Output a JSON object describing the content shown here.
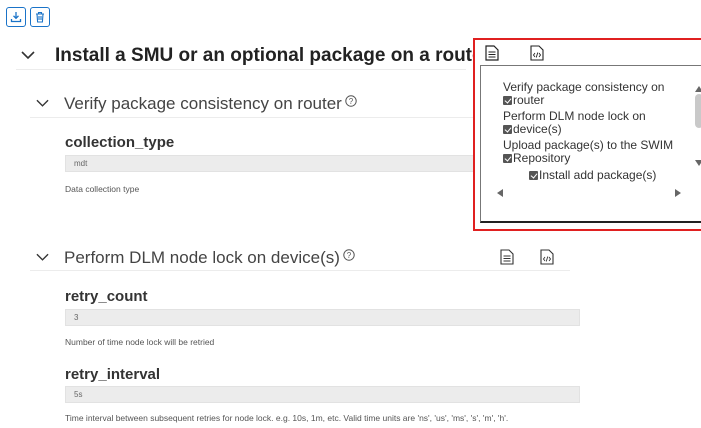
{
  "toolbar": {
    "download_icon": "download-icon",
    "delete_icon": "trash-icon"
  },
  "sections": {
    "main": {
      "title": "Install a SMU or an optional package on a router"
    },
    "verify": {
      "title": "Verify package consistency on router"
    },
    "dlm": {
      "title": "Perform DLM node lock on device(s)"
    }
  },
  "fields": {
    "collection_type": {
      "label": "collection_type",
      "value": "mdt",
      "description": "Data collection type"
    },
    "retry_count": {
      "label": "retry_count",
      "value": "3",
      "description": "Number of time node lock will be retried"
    },
    "retry_interval": {
      "label": "retry_interval",
      "value": "5s",
      "description": "Time interval between subsequent retries for node lock. e.g. 10s, 1m, etc. Valid time units are 'ns', 'us', 'ms', 's', 'm', 'h'."
    }
  },
  "popup": {
    "tree": {
      "line1": "Verify package consistency on",
      "line2": "router",
      "line3": "Perform DLM node lock on",
      "line4": "device(s)",
      "line5": "Upload package(s) to the SWIM",
      "line6": "Repository",
      "line7": "Install add package(s)"
    }
  },
  "colors": {
    "accent": "#1a73c8",
    "highlight_border": "#e02020"
  }
}
